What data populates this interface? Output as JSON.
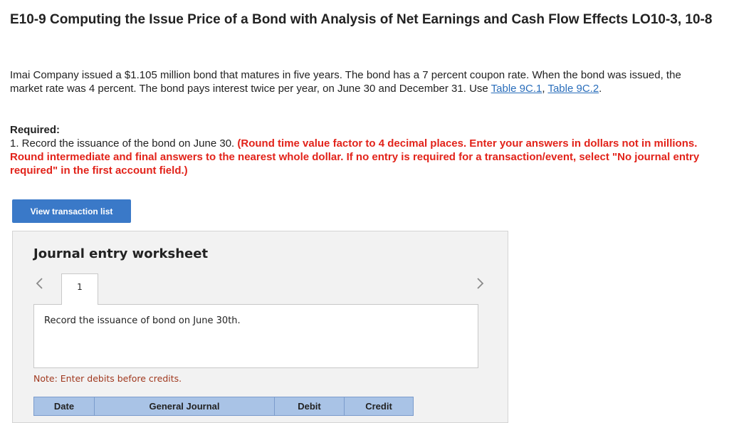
{
  "problem": {
    "title": "E10-9 Computing the Issue Price of a Bond with Analysis of Net Earnings and Cash Flow Effects LO10-3, 10-8",
    "intro_text": "Imai Company issued a $1.105 million bond that matures in five years. The bond has a 7 percent coupon rate. When the bond was issued, the market rate was 4 percent. The bond pays interest twice per year, on June 30 and December 31. Use ",
    "link_1": "Table 9C.1",
    "link_separator": ", ",
    "link_2": "Table 9C.2",
    "intro_end": ".",
    "required_heading": "Required:",
    "requirement_text": "1. Record the issuance of the bond on June 30. ",
    "requirement_instruction": "(Round time value factor to 4 decimal places. Enter your answers in dollars not in millions. Round intermediate and final answers to the nearest whole dollar. If no entry is required for a transaction/event, select \"No journal entry required\" in the first account field.)"
  },
  "view_button_label": "View transaction list",
  "worksheet": {
    "title": "Journal entry worksheet",
    "prev_icon": "<",
    "next_icon": ">",
    "tab_label": "1",
    "instruction": "Record the issuance of bond on June 30th.",
    "note": "Note: Enter debits before credits.",
    "columns": [
      "Date",
      "General Journal",
      "Debit",
      "Credit"
    ]
  }
}
